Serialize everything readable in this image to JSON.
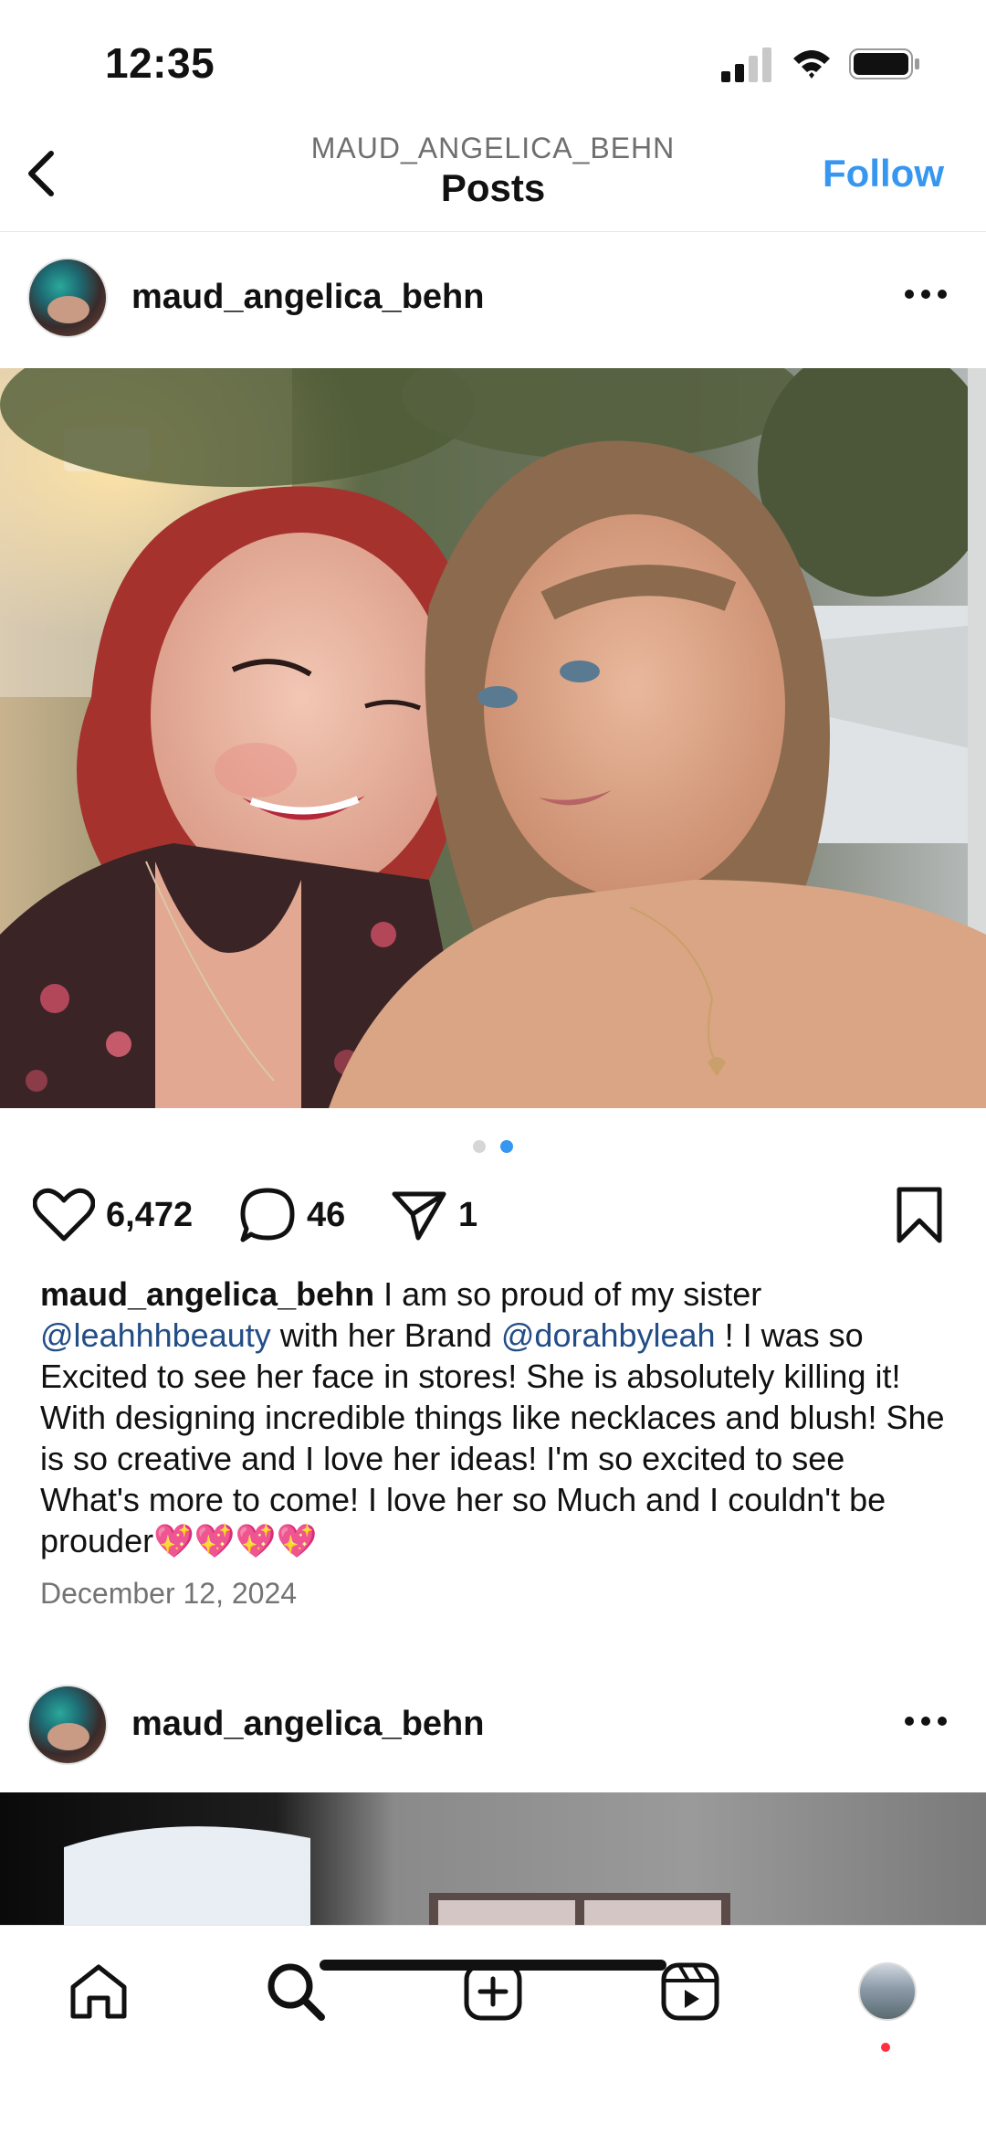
{
  "status_bar": {
    "time": "12:35"
  },
  "header": {
    "subtitle": "MAUD_ANGELICA_BEHN",
    "title": "Posts",
    "follow_label": "Follow"
  },
  "post": {
    "username": "maud_angelica_behn",
    "carousel": {
      "count": 2,
      "active_index": 1
    },
    "likes": "6,472",
    "comments": "46",
    "shares": "1",
    "caption": {
      "username": "maud_angelica_behn",
      "text1": " I am so proud of my sister ",
      "mention1": "@leahhhbeauty",
      "text2": " with her Brand ",
      "mention2": "@dorahbyleah",
      "text3": " ! I was so Excited to see her face in stores! She is absolutely killing it! With designing incredible things like necklaces and blush! She is so creative and I love her ideas! I'm so excited to see What's more to come!  I love her so Much and I couldn't be prouder💖💖💖💖"
    },
    "date": "December 12, 2024"
  },
  "next_post": {
    "username": "maud_angelica_behn"
  },
  "colors": {
    "accent": "#3797f0",
    "mention": "#224d87",
    "notification": "#ff3040"
  },
  "nav": {
    "items": [
      "home-icon",
      "search-icon",
      "create-icon",
      "reels-icon",
      "profile-avatar"
    ]
  }
}
